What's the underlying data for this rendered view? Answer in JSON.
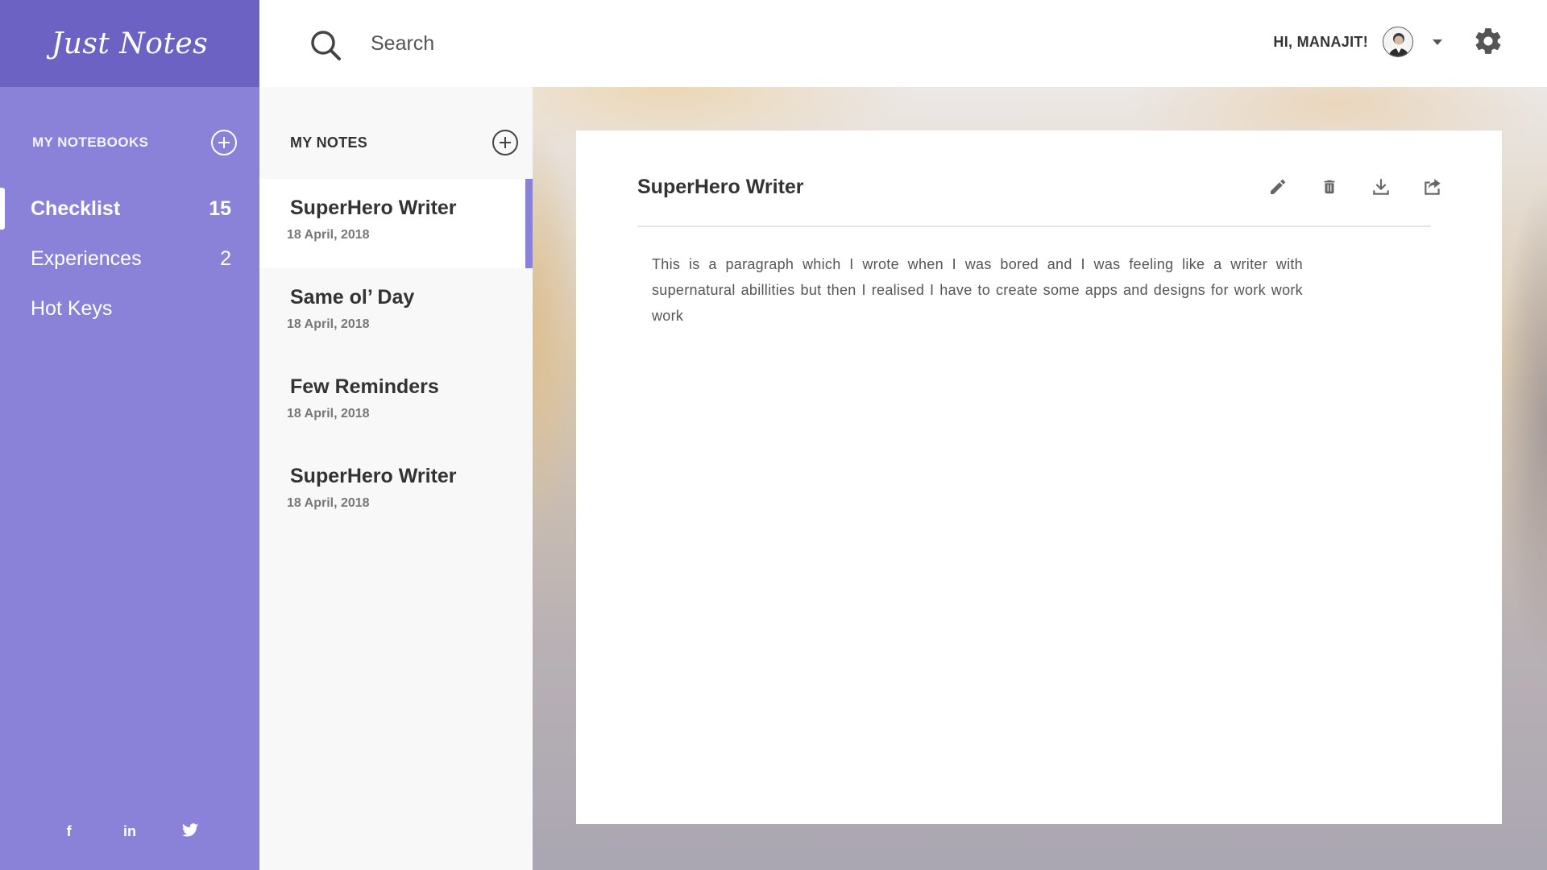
{
  "app": {
    "logo": "Just Notes"
  },
  "sidebar": {
    "notebooks_header": "MY NOTEBOOKS",
    "add_icon": "circle-plus-icon",
    "items": [
      {
        "label": "Checklist",
        "count": "15",
        "active": true
      },
      {
        "label": "Experiences",
        "count": "2",
        "active": false
      },
      {
        "label": "Hot Keys",
        "count": "",
        "active": false
      }
    ],
    "social": {
      "facebook": "f",
      "linkedin": "in",
      "twitter_icon": "twitter-icon"
    }
  },
  "topbar": {
    "search_placeholder": "Search",
    "greeting": "HI, MANAJIT!",
    "settings_icon": "gear-icon"
  },
  "notes": {
    "header": "MY NOTES",
    "items": [
      {
        "title": "SuperHero Writer",
        "date": "18 April, 2018",
        "active": true
      },
      {
        "title": "Same ol’ Day",
        "date": "18 April, 2018",
        "active": false
      },
      {
        "title": "Few Reminders",
        "date": "18 April, 2018",
        "active": false
      },
      {
        "title": "SuperHero Writer",
        "date": "18 April, 2018",
        "active": false
      }
    ]
  },
  "note_view": {
    "title": "SuperHero Writer",
    "body": "This is a paragraph which I wrote when I was bored and I was feeling like a writer with supernatural abillities  but then I realised I have to create some apps and designs for work work work",
    "actions": [
      "pencil-icon",
      "trash-icon",
      "download-icon",
      "share-icon"
    ]
  },
  "colors": {
    "sidebar": "#8a82d8",
    "logo_bar": "#6b62c4",
    "accent": "#8a82d8",
    "notes_bg": "#f8f8f8"
  }
}
